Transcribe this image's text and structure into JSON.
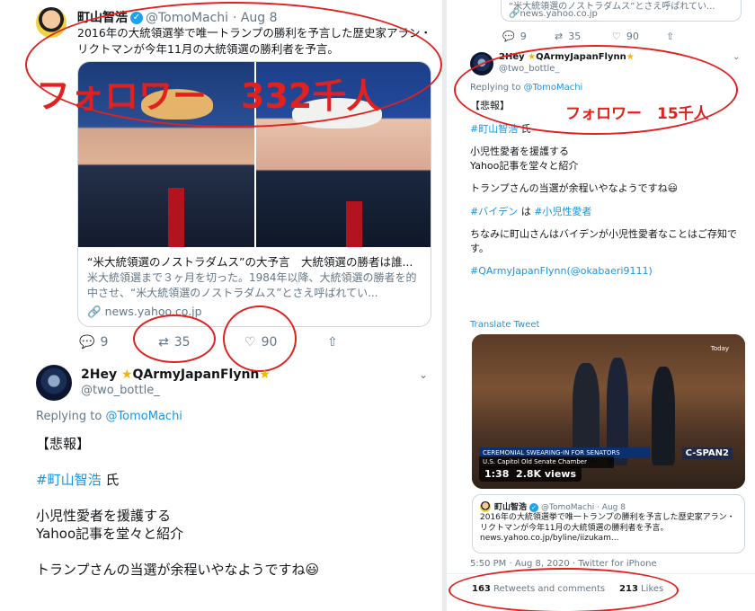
{
  "left": {
    "quoted_top": {
      "display_name": "町山智浩",
      "handle": "@TomoMachi",
      "date": "· Aug 8",
      "text": "2016年の大統領選挙で唯一トランプの勝利を予言した歴史家アラン・リクトマンが今年11月の大統領選の勝利者を予言。",
      "card_title": "“米大統領選のノストラダムス”の大予言　大統領選の勝者は誰...",
      "card_desc": "米大統領選まで３ヶ月を切った。1984年以降、大統領選の勝者を的中させ、“米大統領選のノストラダムス”とさえ呼ばれてい...",
      "card_domain": "news.yahoo.co.jp"
    },
    "annotation_followers": "フォロワー　332千人",
    "actions": {
      "reply": "9",
      "retweet": "35",
      "like": "90"
    },
    "tweet": {
      "display_name": "2Hey",
      "display_name_suffix": "QArmyJapanFlynn",
      "handle": "@two_bottle_",
      "replying_label": "Replying to",
      "replying_to": "@TomoMachi",
      "l1": "【悲報】",
      "l2_tag": "#町山智浩",
      "l2_rest": " 氏",
      "l3": "小児性愛者を援護する",
      "l4": "Yahoo記事を堂々と紹介",
      "l5": "トランプさんの当選が余程いやなようですね😃"
    }
  },
  "right": {
    "top_partial": {
      "desc": "“米大統領選のノストラダムス”とさえ呼ばれてい...",
      "domain": "news.yahoo.co.jp",
      "reply": "9",
      "retweet": "35",
      "like": "90"
    },
    "tweet": {
      "display_name": "2Hey",
      "display_name_suffix": "QArmyJapanFlynn",
      "handle": "@two_bottle_",
      "replying_label": "Replying to",
      "replying_to": "@TomoMachi",
      "l1": "【悲報】",
      "l2_tag": "#町山智浩",
      "l2_rest": " 氏",
      "l3": "小児性愛者を援護する",
      "l4": "Yahoo記事を堂々と紹介",
      "l5": "トランプさんの当選が余程いやなようですね😃",
      "l6_tag1": "#バイデン",
      "l6_mid": " は ",
      "l6_tag2": "#小児性愛者",
      "l7": "ちなみに町山さんはバイデンが小児性愛者なことはご存知です。",
      "l8_tag": "#QArmyJapanFlynn",
      "l8_mention": "(@okabaeri9111)",
      "translate": "Translate Tweet",
      "video_duration": "1:38",
      "video_views": "2.8K views",
      "video_today": "Today",
      "video_caption": "CEREMONIAL SWEARING-IN FOR SENATORS",
      "video_caption2": "U.S. Capitol Old Senate Chamber",
      "video_network": "C-SPAN2",
      "quoted": {
        "display_name": "町山智浩",
        "handle": "@TomoMachi",
        "date": "· Aug 8",
        "text": "2016年の大統領選挙で唯一トランプの勝利を予言した歴史家アラン・リクトマンが今年11月の大統領選の勝利者を予言。",
        "url": "news.yahoo.co.jp/byline/iizukam..."
      },
      "timestamp": "5:50 PM · Aug 8, 2020 · Twitter for iPhone",
      "retweets_count": "163",
      "retweets_label": "Retweets and comments",
      "likes_count": "213",
      "likes_label": "Likes"
    },
    "annotation_followers": "フォロワー　15千人"
  }
}
